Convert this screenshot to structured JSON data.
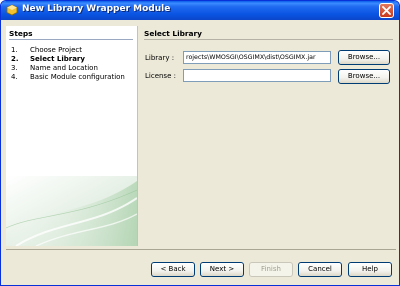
{
  "window": {
    "title": "New Library Wrapper Module",
    "accent_color": "#0a54e3"
  },
  "steps": {
    "heading": "Steps",
    "items": [
      {
        "num": "1.",
        "label": "Choose Project",
        "active": false
      },
      {
        "num": "2.",
        "label": "Select Library",
        "active": true
      },
      {
        "num": "3.",
        "label": "Name and Location",
        "active": false
      },
      {
        "num": "4.",
        "label": "Basic Module configuration",
        "active": false
      }
    ]
  },
  "panel": {
    "title": "Select Library",
    "library_label": "Library :",
    "library_value": "rojects\\WMOSGI\\OSGIMX\\dist\\OSGIMX.jar",
    "license_label": "License :",
    "license_value": "",
    "browse_label": "Browse..."
  },
  "footer": {
    "back": "< Back",
    "next": "Next >",
    "finish": "Finish",
    "cancel": "Cancel",
    "help": "Help"
  }
}
